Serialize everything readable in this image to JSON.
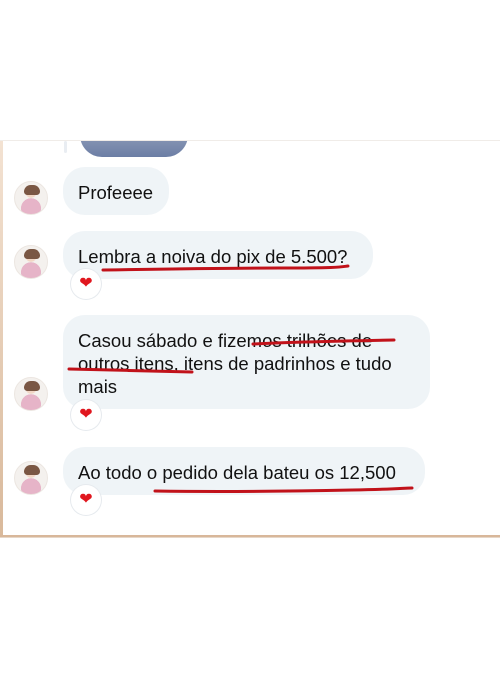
{
  "conversation": {
    "messages": [
      {
        "text": "Profeeee"
      },
      {
        "text": "Lembra a noiva do pix de 5.500?",
        "reaction": "❤"
      },
      {
        "text": "Casou sábado e fizemos trilhões de outros itens, itens de padrinhos e tudo mais",
        "reaction": "❤"
      },
      {
        "text": "Ao todo o pedido dela bateu os 12,500",
        "reaction": "❤"
      }
    ]
  },
  "colors": {
    "bubble_background": "#eff4f7",
    "annotation_underline": "#c1121a",
    "reaction_heart": "#e0161e"
  },
  "icons": {
    "reaction": "heart-icon",
    "sender_avatar": "avatar"
  }
}
